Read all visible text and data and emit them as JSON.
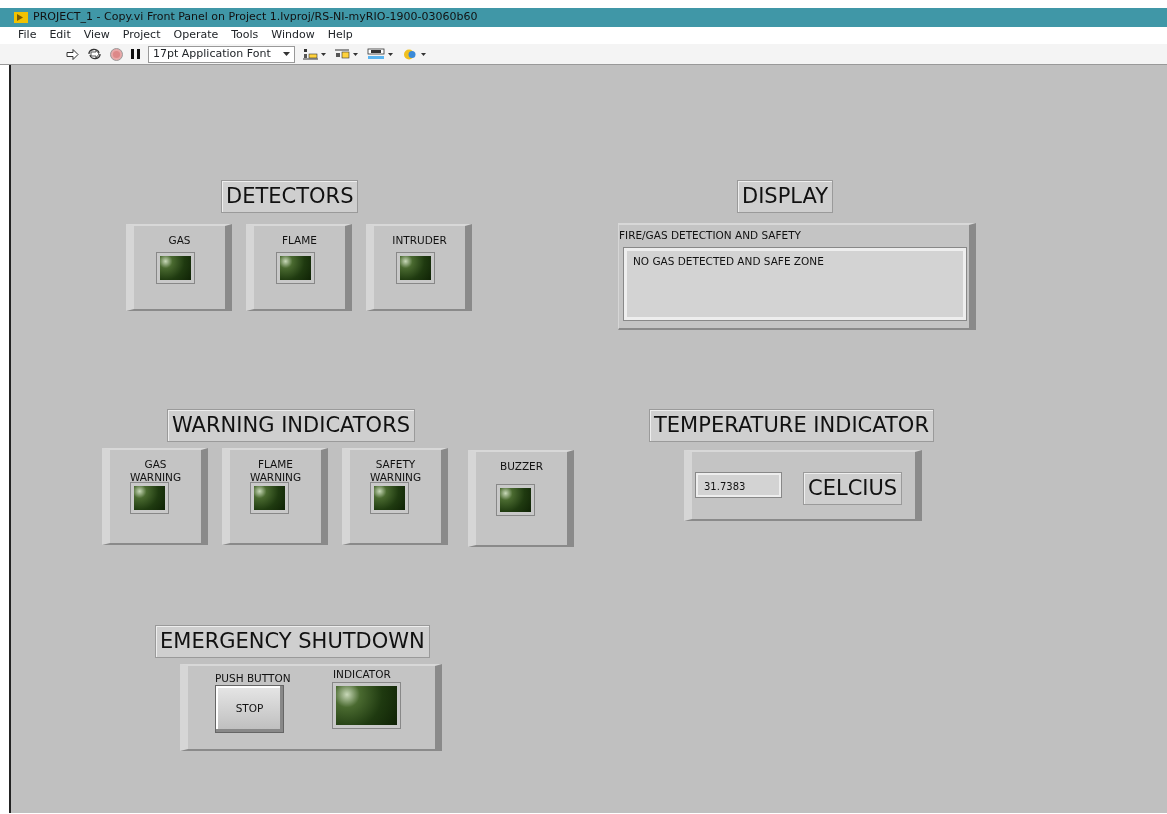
{
  "window": {
    "title": "PROJECT_1 - Copy.vi Front Panel on  Project 1.lvproj/RS-NI-myRIO-1900-03060b60"
  },
  "menu": [
    "File",
    "Edit",
    "View",
    "Project",
    "Operate",
    "Tools",
    "Window",
    "Help"
  ],
  "toolbar": {
    "font_selector": "17pt Application Font"
  },
  "detectors": {
    "title": "DETECTORS",
    "leds": [
      {
        "label": "GAS",
        "on": false
      },
      {
        "label": "FLAME",
        "on": false
      },
      {
        "label": "INTRUDER",
        "on": false
      }
    ]
  },
  "display": {
    "title": "DISPLAY",
    "label": "FIRE/GAS DETECTION AND SAFETY",
    "text": "NO GAS DETECTED AND SAFE ZONE"
  },
  "warnings": {
    "title": "WARNING INDICATORS",
    "leds": [
      {
        "label": "GAS WARNING",
        "on": false
      },
      {
        "label": "FLAME WARNING",
        "on": false
      },
      {
        "label": "SAFETY WARNING",
        "on": false
      },
      {
        "label": "BUZZER",
        "on": false
      }
    ]
  },
  "temperature": {
    "title": "TEMPERATURE INDICATOR",
    "value": "31.7383",
    "unit": "CELCIUS"
  },
  "emergency": {
    "title": "EMERGENCY SHUTDOWN",
    "button_label": "PUSH BUTTON",
    "button": "STOP",
    "indicator_label": "INDICATOR",
    "indicator_on": false
  }
}
